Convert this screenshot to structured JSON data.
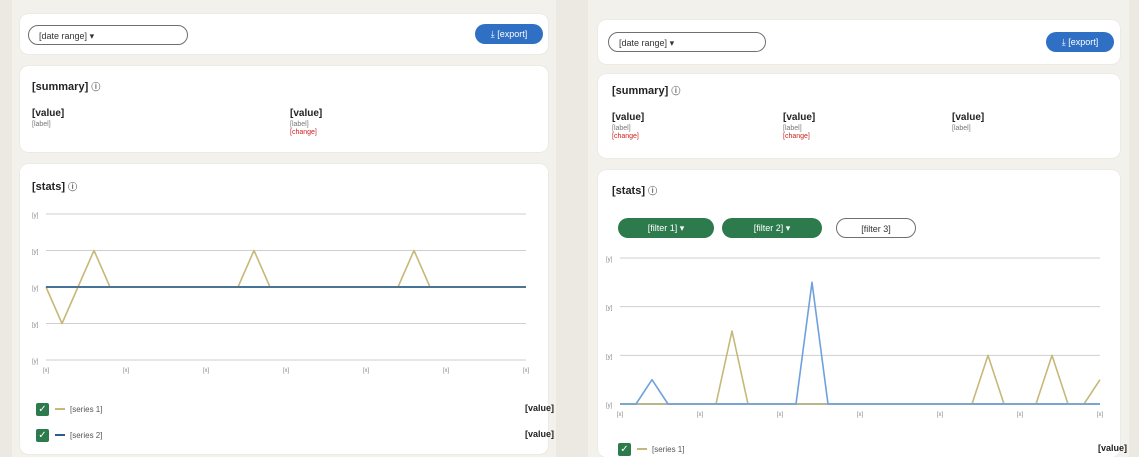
{
  "colors": {
    "accent_blue": "#2f6fc4",
    "accent_green": "#2d7a4c",
    "series_gold": "#c7b87a",
    "series_blue": "#2c5e8c",
    "series_lightblue": "#6fa1dc",
    "negative": "#cc1f1f"
  },
  "left": {
    "date_range": "[date range]",
    "export_label": "[export]",
    "summary": {
      "title": "[summary]",
      "metrics": [
        {
          "value": "[value]",
          "label": "[label]",
          "change": ""
        },
        {
          "value": "[value]",
          "label": "[label]",
          "change": "[change]"
        }
      ]
    },
    "stats": {
      "title": "[stats]",
      "legend": [
        {
          "label": "[series 1]",
          "value": "[value]",
          "color": "#c7b87a"
        },
        {
          "label": "[series 2]",
          "value": "[value]",
          "color": "#2c5e8c"
        }
      ]
    }
  },
  "right": {
    "date_range": "[date range]",
    "export_label": "[export]",
    "summary": {
      "title": "[summary]",
      "metrics": [
        {
          "value": "[value]",
          "label": "[label]",
          "change": "[change]"
        },
        {
          "value": "[value]",
          "label": "[label]",
          "change": "[change]"
        },
        {
          "value": "[value]",
          "label": "[label]",
          "change": ""
        }
      ]
    },
    "stats": {
      "title": "[stats]",
      "filters": [
        "[filter 1]",
        "[filter 2]",
        "[filter 3]"
      ],
      "legend": [
        {
          "label": "[series 1]",
          "value": "[value]",
          "color": "#c7b87a"
        }
      ]
    }
  },
  "chart_data": [
    {
      "type": "line",
      "ylim": [
        -2,
        2
      ],
      "yticks": [
        "[y]",
        "[y]",
        "[y]",
        "[y]",
        "[y]"
      ],
      "xticks": [
        "[x]",
        "[x]",
        "[x]",
        "[x]",
        "[x]",
        "[x]",
        "[x]"
      ],
      "x": [
        1,
        2,
        3,
        4,
        5,
        6,
        7,
        8,
        9,
        10,
        11,
        12,
        13,
        14,
        15,
        16,
        17,
        18,
        19,
        20,
        21,
        22,
        23,
        24,
        25,
        26,
        27,
        28,
        29,
        30,
        31
      ],
      "series": [
        {
          "values": [
            0,
            -1,
            0,
            1,
            0,
            0,
            0,
            0,
            0,
            0,
            0,
            0,
            0,
            1,
            0,
            0,
            0,
            0,
            0,
            0,
            0,
            0,
            0,
            1,
            0,
            0,
            0,
            0,
            0,
            0,
            0
          ]
        },
        {
          "values": [
            0,
            0,
            0,
            0,
            0,
            0,
            0,
            0,
            0,
            0,
            0,
            0,
            0,
            0,
            0,
            0,
            0,
            0,
            0,
            0,
            0,
            0,
            0,
            0,
            0,
            0,
            0,
            0,
            0,
            0,
            0
          ]
        }
      ]
    },
    {
      "type": "line",
      "ylim": [
        0,
        6
      ],
      "yticks": [
        "[y]",
        "[y]",
        "[y]",
        "[y]"
      ],
      "xticks": [
        "[x]",
        "[x]",
        "[x]",
        "[x]",
        "[x]",
        "[x]",
        "[x]"
      ],
      "x": [
        1,
        2,
        3,
        4,
        5,
        6,
        7,
        8,
        9,
        10,
        11,
        12,
        13,
        14,
        15,
        16,
        17,
        18,
        19,
        20,
        21,
        22,
        23,
        24,
        25,
        26,
        27,
        28,
        29,
        30,
        31
      ],
      "series": [
        {
          "values": [
            0,
            0,
            0,
            0,
            0,
            0,
            0,
            3,
            0,
            0,
            0,
            0,
            0,
            0,
            0,
            0,
            0,
            0,
            0,
            0,
            0,
            0,
            0,
            2,
            0,
            0,
            0,
            2,
            0,
            0,
            1
          ]
        },
        {
          "values": [
            0,
            0,
            1,
            0,
            0,
            0,
            0,
            0,
            0,
            0,
            0,
            0,
            5,
            0,
            0,
            0,
            0,
            0,
            0,
            0,
            0,
            0,
            0,
            0,
            0,
            0,
            0,
            0,
            0,
            0,
            0
          ]
        }
      ]
    }
  ]
}
